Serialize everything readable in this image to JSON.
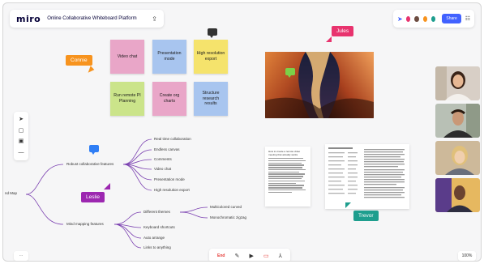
{
  "topbar": {
    "logo": "miro",
    "board_title": "Online Collaborative Whiteboard Platform",
    "share_label": "Share"
  },
  "icons": [
    "upload-icon",
    "cursor-icon",
    "board-menu-icon",
    "select-tool-icon",
    "sticky-note-tool-icon",
    "comment-tool-icon",
    "more-tools-icon",
    "camera-icon",
    "screen-share-icon",
    "cursor-tool-icon",
    "chat-icon"
  ],
  "stickies": [
    {
      "text": "Video chat",
      "color": "#e9a6c8"
    },
    {
      "text": "Presentation mode",
      "color": "#a8c5ef"
    },
    {
      "text": "High resolution export",
      "color": "#f5e36c"
    },
    {
      "text": "Run remote PI Planning",
      "color": "#cbe48a"
    },
    {
      "text": "Create org charts",
      "color": "#e9a6c8"
    },
    {
      "text": "Structure research results",
      "color": "#a8c5ef"
    }
  ],
  "cursors": {
    "connie": {
      "name": "Connie",
      "color": "#f7931e"
    },
    "jules": {
      "name": "Jules",
      "color": "#e8336e"
    },
    "leslie": {
      "name": "Leslie",
      "color": "#9c27b0"
    },
    "trevor": {
      "name": "Trevor",
      "color": "#1e9e8e"
    }
  },
  "mindmap": {
    "root": "nd Map",
    "branch1": "Robust collaborative features",
    "branch1_children": [
      "Real time collaboration",
      "Endless canvas",
      "Comments",
      "Video chat",
      "Presentation mode",
      "High resolution export"
    ],
    "branch2": "Mind mapping features",
    "branch2_children": [
      "Different themes",
      "Keyboard shortcuts",
      "Auto arrange",
      "Links to anything"
    ],
    "themes_children": [
      "Multicolored curved",
      "Monochromatic zigzag"
    ]
  },
  "doc": {
    "title": "How to create a remote video meeting that actually works"
  },
  "bottom_bar": {
    "end_label": "End"
  },
  "zoom": "100%",
  "colors": {
    "accent": "#4262ff",
    "mindmap_line": "#7a3fb0"
  }
}
